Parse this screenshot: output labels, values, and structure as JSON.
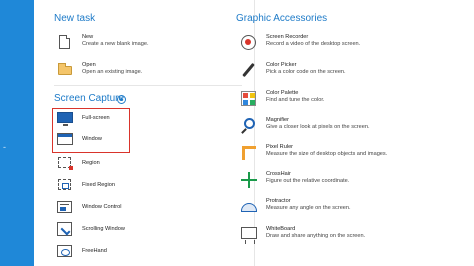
{
  "left_column": {
    "new_task_title": "New task",
    "new_task_items": [
      {
        "title": "New",
        "desc": "Create a new blank image.",
        "icon": "new-document-icon"
      },
      {
        "title": "Open",
        "desc": "Open an existing image.",
        "icon": "folder-open-icon"
      }
    ],
    "screen_capture_title": "Screen Capture",
    "screen_capture_items": [
      {
        "title": "Full-screen",
        "icon": "monitor-icon"
      },
      {
        "title": "Window",
        "icon": "window-icon"
      },
      {
        "title": "Region",
        "icon": "region-icon"
      },
      {
        "title": "Fixed Region",
        "icon": "fixed-region-icon"
      },
      {
        "title": "Window Control",
        "icon": "window-control-icon"
      },
      {
        "title": "Scrolling Window",
        "icon": "scrolling-window-icon"
      },
      {
        "title": "FreeHand",
        "icon": "freehand-icon"
      }
    ]
  },
  "right_column": {
    "title": "Graphic Accessories",
    "items": [
      {
        "title": "Screen Recorder",
        "desc": "Record a video of the desktop screen.",
        "icon": "record-icon"
      },
      {
        "title": "Color Picker",
        "desc": "Pick a color code on the screen.",
        "icon": "eyedropper-icon"
      },
      {
        "title": "Color Palette",
        "desc": "Find and tune the color.",
        "icon": "palette-icon"
      },
      {
        "title": "Magnifier",
        "desc": "Give a closer look at pixels on the screen.",
        "icon": "magnifier-icon"
      },
      {
        "title": "Pixel Ruler",
        "desc": "Measure the size of desktop objects and images.",
        "icon": "ruler-icon"
      },
      {
        "title": "CrossHair",
        "desc": "Figure out the relative coordinate.",
        "icon": "crosshair-icon"
      },
      {
        "title": "Protractor",
        "desc": "Measure any angle on the screen.",
        "icon": "protractor-icon"
      },
      {
        "title": "WhiteBoard",
        "desc": "Draw and share anything on the screen.",
        "icon": "whiteboard-icon"
      }
    ]
  },
  "colors": {
    "accent": "#1e7bc8",
    "sidebar": "#1f88d8",
    "highlight": "#d9342b"
  }
}
